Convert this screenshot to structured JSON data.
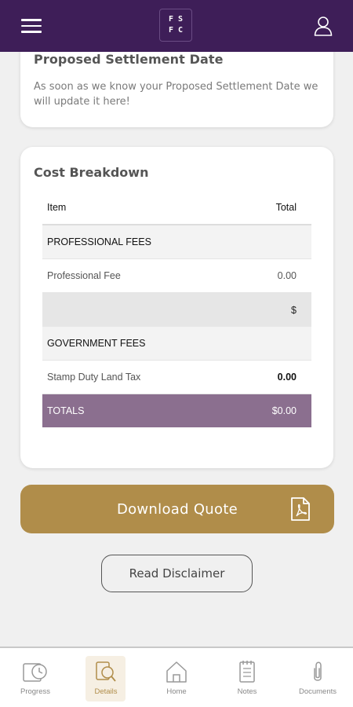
{
  "header": {
    "logo_letters": [
      "F",
      "S",
      "F",
      "C"
    ]
  },
  "settlement": {
    "title": "Proposed Settlement Date",
    "description": "As soon as we know your Proposed Settlement Date we will update it here!"
  },
  "cost": {
    "title": "Cost Breakdown",
    "columns": {
      "item": "Item",
      "total": "Total"
    },
    "professional_section": "PROFESSIONAL FEES",
    "professional_fee": {
      "label": "Professional Fee",
      "value": "0.00"
    },
    "subtotal_currency": "$",
    "government_section": "GOVERNMENT FEES",
    "stamp_duty": {
      "label": "Stamp Duty Land Tax",
      "value": "0.00"
    },
    "totals": {
      "label": "TOTALS",
      "value": "$0.00"
    }
  },
  "actions": {
    "download_label": "Download Quote",
    "disclaimer_label": "Read Disclaimer"
  },
  "nav": {
    "progress": "Progress",
    "details": "Details",
    "home": "Home",
    "notes": "Notes",
    "documents": "Documents",
    "active": "details"
  },
  "colors": {
    "header_bg": "#3e1e58",
    "accent_gold": "#b08d4a",
    "totals_bg": "#8b6f8f"
  },
  "icons": [
    "menu-icon",
    "user-icon",
    "pdf-icon",
    "progress-clock-icon",
    "details-search-icon",
    "home-icon",
    "notes-icon",
    "paperclip-icon"
  ]
}
